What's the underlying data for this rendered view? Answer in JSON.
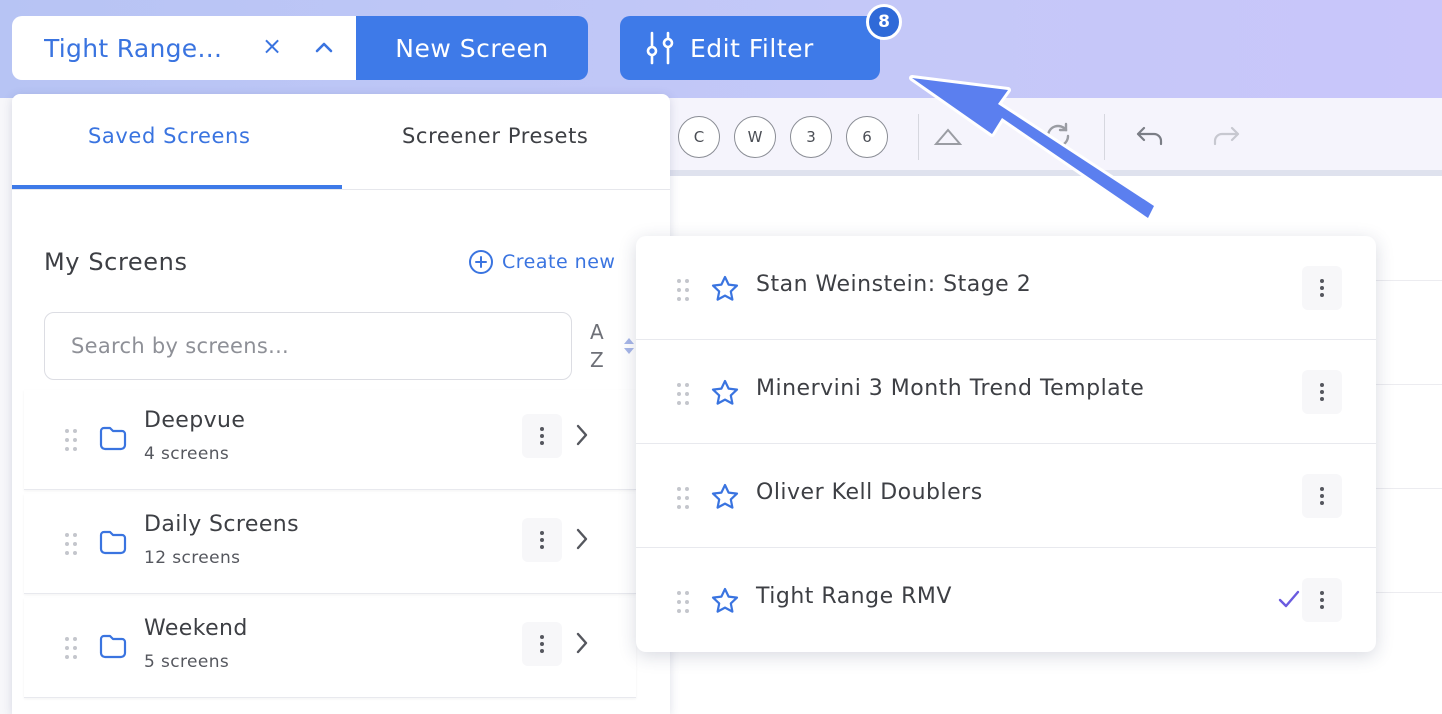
{
  "header": {
    "selected_screen": "Tight Range...",
    "clear_symbol": "×",
    "new_screen_label": "New Screen",
    "edit_filter_label": "Edit Filter",
    "filter_count": "8"
  },
  "toolbar": {
    "timeframes": [
      "C",
      "W",
      "3",
      "6"
    ]
  },
  "panel": {
    "tabs": [
      {
        "label": "Saved Screens",
        "active": true
      },
      {
        "label": "Screener Presets",
        "active": false
      }
    ],
    "section_title": "My Screens",
    "create_new_label": "Create new",
    "search_placeholder": "Search by screens...",
    "sort_top": "A",
    "sort_bottom": "Z",
    "folders": [
      {
        "name": "Deepvue",
        "count": "4 screens"
      },
      {
        "name": "Daily Screens",
        "count": "12 screens"
      },
      {
        "name": "Weekend",
        "count": "5 screens"
      }
    ]
  },
  "dropdown": {
    "items": [
      {
        "label": "Stan Weinstein: Stage 2",
        "selected": false
      },
      {
        "label": "Minervini 3 Month Trend Template",
        "selected": false
      },
      {
        "label": "Oliver Kell Doublers",
        "selected": false
      },
      {
        "label": "Tight Range RMV",
        "selected": true
      }
    ]
  },
  "colors": {
    "accent": "#3e7ae8",
    "arrow": "#5b7fef",
    "check": "#6a5bdf"
  }
}
